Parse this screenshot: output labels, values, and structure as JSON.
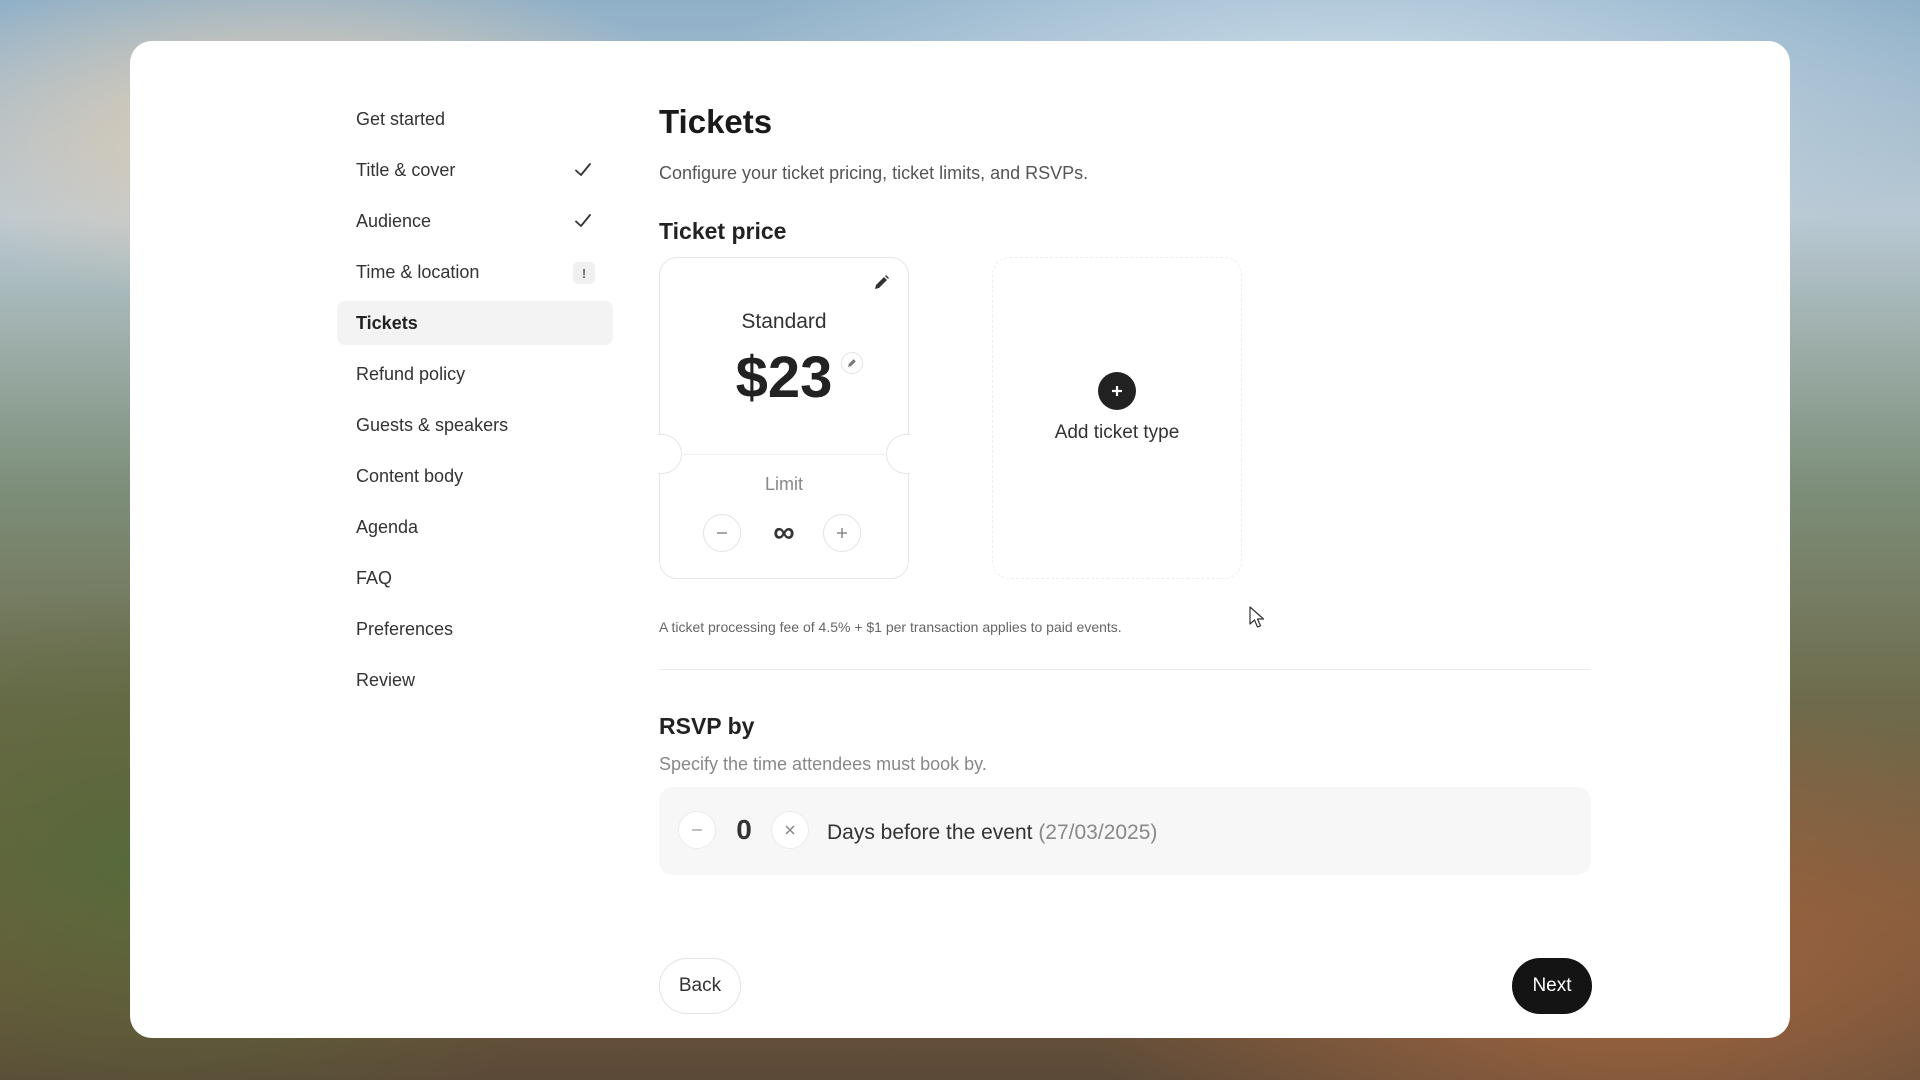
{
  "sidebar": {
    "items": [
      {
        "label": "Get started"
      },
      {
        "label": "Title & cover"
      },
      {
        "label": "Audience"
      },
      {
        "label": "Time & location",
        "badge": "!"
      },
      {
        "label": "Tickets"
      },
      {
        "label": "Refund policy"
      },
      {
        "label": "Guests & speakers"
      },
      {
        "label": "Content body"
      },
      {
        "label": "Agenda"
      },
      {
        "label": "FAQ"
      },
      {
        "label": "Preferences"
      },
      {
        "label": "Review"
      }
    ]
  },
  "main": {
    "title": "Tickets",
    "subtitle": "Configure your ticket pricing, ticket limits, and RSVPs.",
    "ticket_price": {
      "heading": "Ticket price",
      "tickets": [
        {
          "name": "Standard",
          "price": "$23",
          "limit_label": "Limit",
          "limit_value": "∞"
        }
      ],
      "add_label": "Add ticket type",
      "fee_note": "A ticket processing fee of 4.5% + $1 per transaction applies to paid events."
    },
    "rsvp": {
      "heading": "RSVP by",
      "subtitle": "Specify the time attendees must book by.",
      "value": "0",
      "text": "Days before the event",
      "date": "(27/03/2025)"
    }
  },
  "footer": {
    "back_label": "Back",
    "next_label": "Next"
  },
  "colors": {
    "accent": "#141414",
    "active_bg": "#f3f3f3"
  }
}
